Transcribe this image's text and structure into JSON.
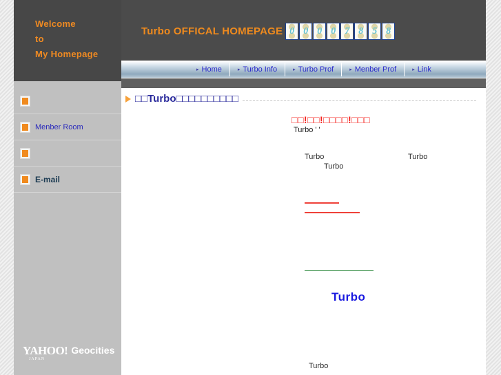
{
  "sidebar": {
    "welcome": {
      "line1": "Welcome",
      "line2": "to",
      "line3": "My Homepage"
    },
    "items": [
      {
        "label": "",
        "icon": "broken-image-icon"
      },
      {
        "label": "Menber Room",
        "icon": "broken-image-icon"
      },
      {
        "label": "",
        "icon": "broken-image-icon"
      },
      {
        "label": "E-mail",
        "icon": "broken-image-icon"
      }
    ],
    "footer": {
      "yahoo": "YAHOO!",
      "japan": "JAPAN",
      "geocities": "Geocities"
    }
  },
  "header": {
    "title": "Turbo OFFICAL HOMEPAGE",
    "counter_digits": [
      "0",
      "0",
      "0",
      "0",
      "7",
      "8",
      "5",
      "8"
    ]
  },
  "nav": {
    "arrow_glyph": "▸",
    "items": [
      {
        "label": "Home"
      },
      {
        "label": "Turbo Info"
      },
      {
        "label": "Turbo Prof"
      },
      {
        "label": "Menber Prof"
      },
      {
        "label": "Link"
      }
    ]
  },
  "main": {
    "headline": "□□Turbo□□□□□□□□□□",
    "red_headline": "□□!□□!□□□□!□□□",
    "sub_turbo": "Turbo '    '",
    "text_1": "Turbo",
    "text_2": "Turbo",
    "text_3": "Turbo",
    "blue_turbo": "Turbo",
    "text_bottom": "Turbo"
  },
  "colors": {
    "accent_orange": "#ee8a1e",
    "dark_header": "#4b4b4b",
    "sidebar_gray": "#c0c0c0",
    "link_blue": "#2b2bcc",
    "red": "#f5211c",
    "green_rule": "#2e8b3f",
    "blue_text": "#1a1ae0"
  }
}
